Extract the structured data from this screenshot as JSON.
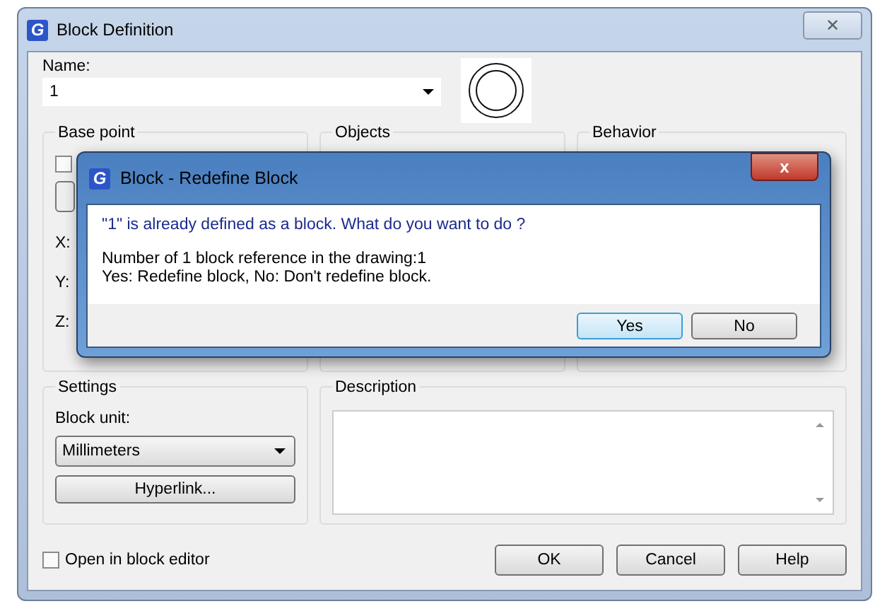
{
  "window": {
    "title": "Block Definition",
    "close": "✕",
    "logo": "G"
  },
  "name": {
    "label": "Name:",
    "value": "1"
  },
  "groups": [
    {
      "title": "Base point",
      "kind": "base"
    },
    {
      "title": "Objects",
      "kind": "objects"
    },
    {
      "title": "Behavior",
      "kind": "behavior"
    }
  ],
  "base_point": {
    "specify_checked": false,
    "coords": [
      "X:",
      "Y:",
      "Z:"
    ]
  },
  "settings": {
    "title": "Settings",
    "unit_label": "Block unit:",
    "unit_value": "Millimeters",
    "hyperlink": "Hyperlink..."
  },
  "description": {
    "title": "Description"
  },
  "open_in_editor": {
    "label": "Open in block editor",
    "checked": false
  },
  "buttons": [
    "OK",
    "Cancel",
    "Help"
  ],
  "modal": {
    "logo": "G",
    "title": "Block - Redefine Block",
    "close": "x",
    "question": "\"1\" is already defined as a block. What do you want to do ?",
    "lines": [
      "Number of 1 block reference in the drawing:1",
      "Yes: Redefine block, No: Don't redefine block."
    ],
    "buttons": [
      {
        "label": "Yes",
        "selected": true
      },
      {
        "label": "No",
        "selected": false
      }
    ]
  }
}
